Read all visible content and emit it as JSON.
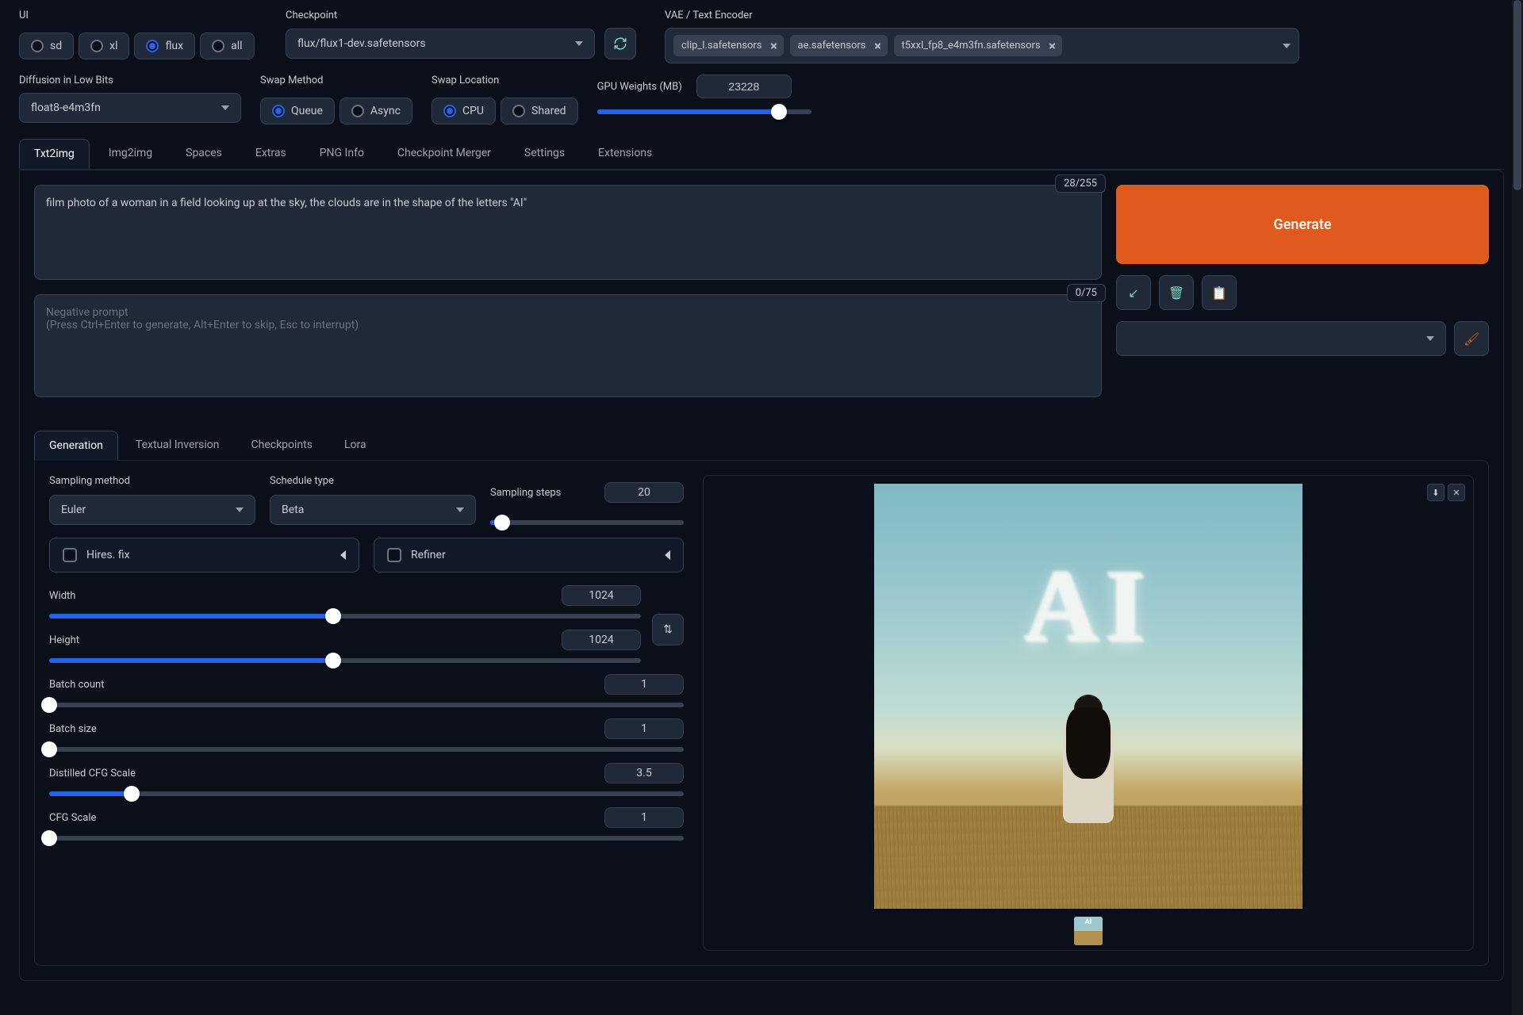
{
  "top": {
    "ui": {
      "label": "UI",
      "options": [
        "sd",
        "xl",
        "flux",
        "all"
      ],
      "selected": "flux"
    },
    "checkpoint": {
      "label": "Checkpoint",
      "value": "flux/flux1-dev.safetensors"
    },
    "vae": {
      "label": "VAE / Text Encoder",
      "chips": [
        "clip_l.safetensors",
        "ae.safetensors",
        "t5xxl_fp8_e4m3fn.safetensors"
      ]
    }
  },
  "toolbar2": {
    "lowbits": {
      "label": "Diffusion in Low Bits",
      "value": "float8-e4m3fn"
    },
    "swap_method": {
      "label": "Swap Method",
      "options": [
        "Queue",
        "Async"
      ],
      "selected": "Queue"
    },
    "swap_location": {
      "label": "Swap Location",
      "options": [
        "CPU",
        "Shared"
      ],
      "selected": "CPU"
    },
    "gpu_weights": {
      "label": "GPU Weights (MB)",
      "value": "23228",
      "percent": 85
    }
  },
  "tabs": [
    "Txt2img",
    "Img2img",
    "Spaces",
    "Extras",
    "PNG Info",
    "Checkpoint Merger",
    "Settings",
    "Extensions"
  ],
  "active_tab": "Txt2img",
  "prompt": {
    "text": "film photo of a woman in a field looking up at the sky, the clouds are in the shape of the letters \"AI\"",
    "counter": "28/255"
  },
  "neg_prompt": {
    "placeholder_line1": "Negative prompt",
    "placeholder_line2": "(Press Ctrl+Enter to generate, Alt+Enter to skip, Esc to interrupt)",
    "counter": "0/75"
  },
  "generate_label": "Generate",
  "subtabs": [
    "Generation",
    "Textual Inversion",
    "Checkpoints",
    "Lora"
  ],
  "active_subtab": "Generation",
  "gen": {
    "sampling_method": {
      "label": "Sampling method",
      "value": "Euler"
    },
    "schedule_type": {
      "label": "Schedule type",
      "value": "Beta"
    },
    "sampling_steps": {
      "label": "Sampling steps",
      "value": "20",
      "percent": 6
    },
    "hires_fix": "Hires. fix",
    "refiner": "Refiner",
    "width": {
      "label": "Width",
      "value": "1024",
      "percent": 48
    },
    "height": {
      "label": "Height",
      "value": "1024",
      "percent": 48
    },
    "batch_count": {
      "label": "Batch count",
      "value": "1",
      "percent": 0
    },
    "batch_size": {
      "label": "Batch size",
      "value": "1",
      "percent": 0
    },
    "distilled_cfg": {
      "label": "Distilled CFG Scale",
      "value": "3.5",
      "percent": 13
    },
    "cfg": {
      "label": "CFG Scale",
      "value": "1",
      "percent": 0
    }
  },
  "preview": {
    "cloud_text": "AI",
    "thumb_text": "AI"
  },
  "chart_data": {
    "type": "table",
    "title": "Txt2img generation parameters",
    "rows": [
      {
        "name": "Sampling method",
        "value": "Euler"
      },
      {
        "name": "Schedule type",
        "value": "Beta"
      },
      {
        "name": "Sampling steps",
        "value": 20
      },
      {
        "name": "Width",
        "value": 1024
      },
      {
        "name": "Height",
        "value": 1024
      },
      {
        "name": "Batch count",
        "value": 1
      },
      {
        "name": "Batch size",
        "value": 1
      },
      {
        "name": "Distilled CFG Scale",
        "value": 3.5
      },
      {
        "name": "CFG Scale",
        "value": 1
      },
      {
        "name": "GPU Weights (MB)",
        "value": 23228
      }
    ]
  }
}
